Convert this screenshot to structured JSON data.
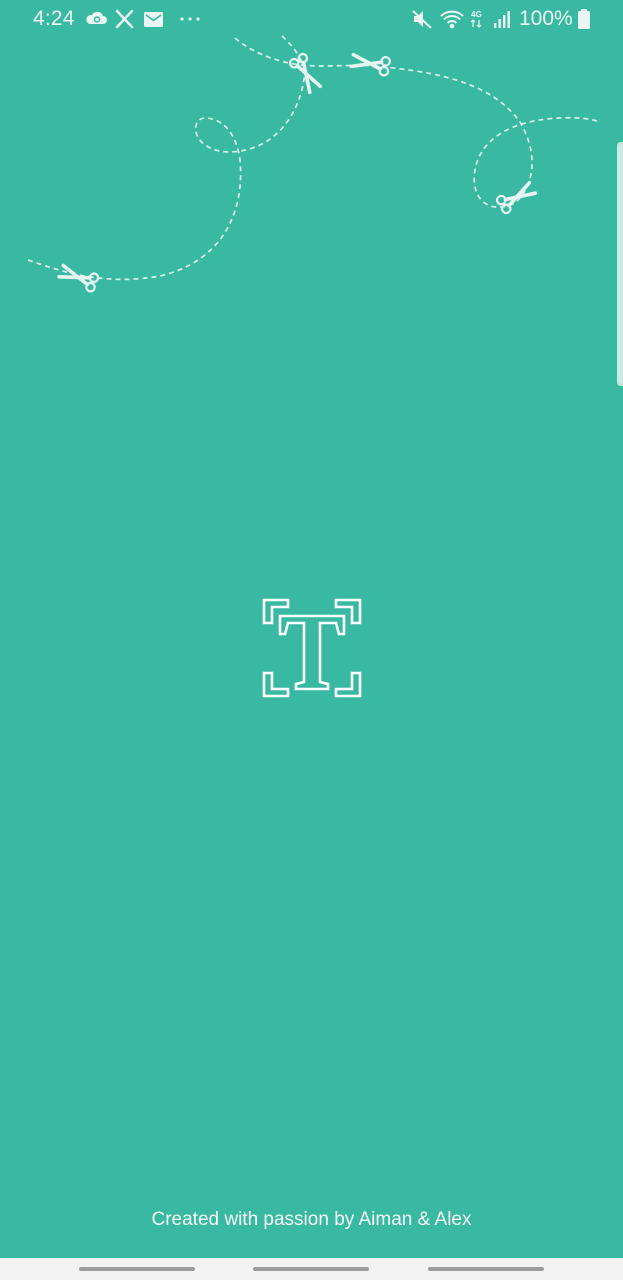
{
  "status_bar": {
    "time": "4:24",
    "battery_percent": "100%",
    "left_icons": [
      "cloud-sync-icon",
      "x-logo-icon",
      "mail-icon",
      "more-dots-icon"
    ],
    "right_icons": [
      "mute-icon",
      "wifi-icon",
      "4g-icon",
      "signal-icon",
      "battery-icon"
    ]
  },
  "credit_text": "Created with passion by Aiman & Alex",
  "app_logo_icon": "text-recognition-logo",
  "decor_icons": [
    "scissors-icon",
    "dashed-cut-line"
  ],
  "colors": {
    "background": "#3ab9a2",
    "foreground": "#ffffff",
    "nav_bar": "#f3f3f3"
  }
}
